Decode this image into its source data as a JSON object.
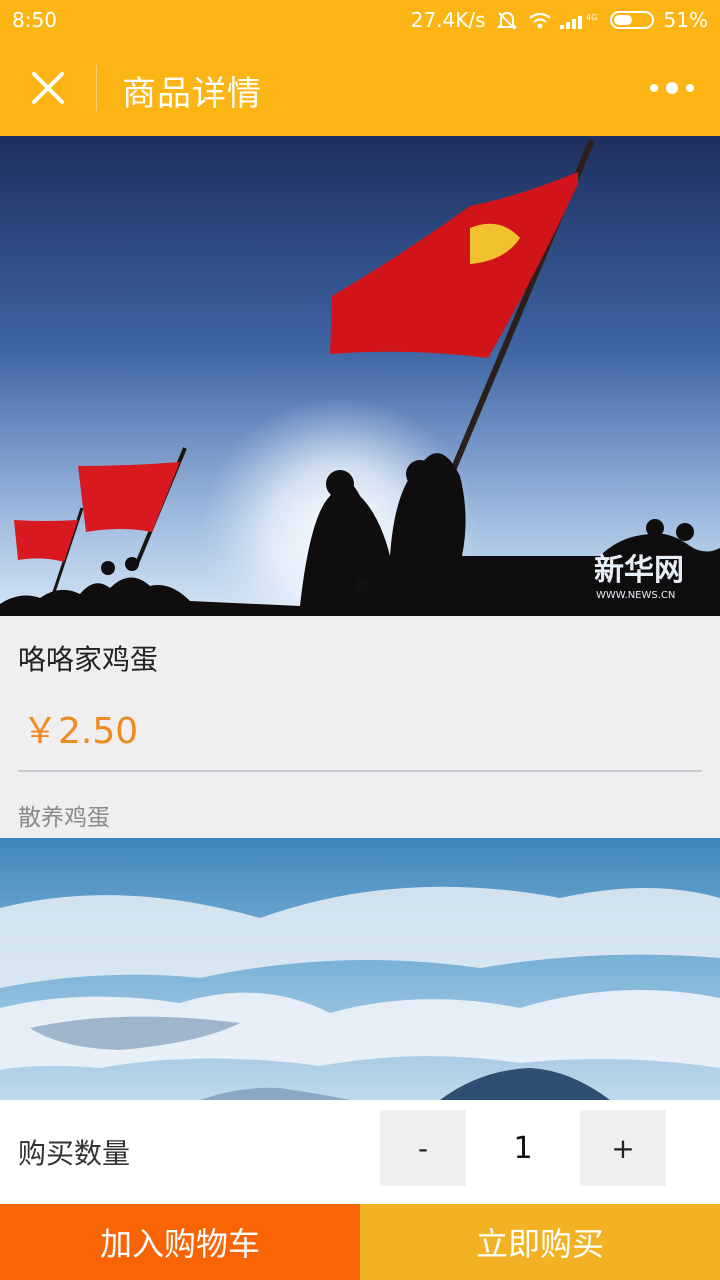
{
  "status_bar": {
    "time": "8:50",
    "network_speed": "27.4K/s",
    "network_type": "4G",
    "battery": "51%",
    "battery_level": 0.51
  },
  "header": {
    "title": "商品详情"
  },
  "hero_image": {
    "watermark_text": "新华网",
    "watermark_url": "WWW.NEWS.CN"
  },
  "product": {
    "name": "咯咯家鸡蛋",
    "price": "￥2.50",
    "description": "散养鸡蛋"
  },
  "quantity": {
    "label": "购买数量",
    "minus": "-",
    "value": "1",
    "plus": "+"
  },
  "actions": {
    "add_to_cart": "加入购物车",
    "buy_now": "立即购买"
  },
  "colors": {
    "brand": "#fcb515",
    "price": "#f08a1c",
    "cart_button": "#f96505",
    "buy_button": "#f3b223"
  }
}
